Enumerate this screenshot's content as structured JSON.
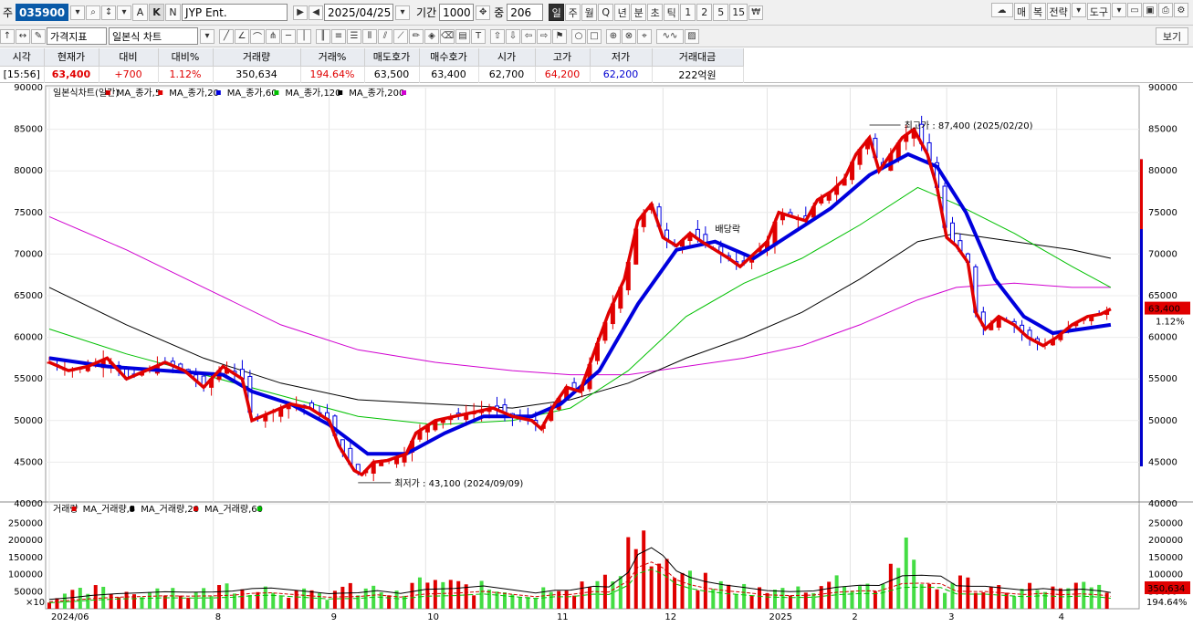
{
  "toolbar": {
    "market_label": "주",
    "stock_code": "035900",
    "letters": [
      "A",
      "K",
      "N"
    ],
    "stock_name": "JYP Ent.",
    "date": "2025/04/25",
    "period_label": "기간",
    "period_value": "1000",
    "count_label": "중",
    "count_value": "206",
    "timeframes": [
      "일",
      "주",
      "월",
      "Q",
      "년",
      "분",
      "초",
      "틱",
      "1",
      "2",
      "5",
      "15"
    ],
    "right_buttons": [
      "매",
      "복",
      "전략",
      "도구"
    ],
    "price_indicator_label": "가격지표",
    "chart_type_label": "일본식 차트",
    "view_label": "보기"
  },
  "quote": {
    "headers": [
      "시각",
      "현재가",
      "대비",
      "대비%",
      "거래량",
      "거래%",
      "매도호가",
      "매수호가",
      "시가",
      "고가",
      "저가",
      "거래대금"
    ],
    "values": [
      "[15:56]",
      "63,400",
      "+700",
      "1.12%",
      "350,634",
      "194.64%",
      "63,500",
      "63,400",
      "62,700",
      "64,200",
      "62,200",
      "222억원"
    ]
  },
  "chart_data": {
    "type": "candlestick",
    "legend_price": "일본식차트(일간) ■ MA_종가,5 ■ MA_종가,20 ■ MA_종가,60 ■ MA_종가,120 ■ MA_종가,200",
    "legend_price_items": [
      {
        "name": "일본식차트(일간)",
        "color": "#d00000"
      },
      {
        "name": "MA_종가,5",
        "color": "#e00000"
      },
      {
        "name": "MA_종가,20",
        "color": "#0000dd"
      },
      {
        "name": "MA_종가,60",
        "color": "#00c000"
      },
      {
        "name": "MA_종가,120",
        "color": "#000000"
      },
      {
        "name": "MA_종가,200",
        "color": "#d000d0"
      }
    ],
    "legend_volume_items": [
      {
        "name": "거래량",
        "color": "#e00000"
      },
      {
        "name": "MA_거래량,5",
        "color": "#000000"
      },
      {
        "name": "MA_거래량,20",
        "color": "#d00000"
      },
      {
        "name": "MA_거래량,60",
        "color": "#00c000"
      }
    ],
    "price_ylim": [
      40000,
      90000
    ],
    "price_ticks": [
      90000,
      85000,
      80000,
      75000,
      70000,
      65000,
      60000,
      55000,
      50000,
      45000,
      40000
    ],
    "volume_ylim": [
      0,
      280000
    ],
    "volume_ticks": [
      250000,
      200000,
      150000,
      100000,
      50000
    ],
    "volume_unit": "×10",
    "x_labels": [
      "2024/06",
      "8",
      "9",
      "10",
      "11",
      "12",
      "2025",
      "2",
      "3",
      "4"
    ],
    "annotations": {
      "high": "최고가 : 87,400 (2025/02/20)",
      "low": "최저가 : 43,100 (2024/09/09)",
      "dividend": "배당락"
    },
    "last_price": "63,400",
    "last_change": "1.12%",
    "last_volume": "350,634",
    "last_volume_pct": "194.64%",
    "price_path": [
      [
        0,
        57000
      ],
      [
        10,
        56000
      ],
      [
        20,
        56500
      ],
      [
        30,
        57500
      ],
      [
        40,
        55000
      ],
      [
        50,
        56000
      ],
      [
        60,
        57000
      ],
      [
        70,
        56000
      ],
      [
        80,
        54000
      ],
      [
        90,
        56500
      ],
      [
        100,
        55000
      ],
      [
        105,
        50000
      ],
      [
        115,
        51000
      ],
      [
        125,
        52000
      ],
      [
        135,
        51500
      ],
      [
        145,
        50000
      ],
      [
        150,
        47000
      ],
      [
        158,
        44000
      ],
      [
        162,
        43500
      ],
      [
        168,
        45000
      ],
      [
        175,
        45200
      ],
      [
        185,
        46000
      ],
      [
        190,
        48500
      ],
      [
        200,
        50000
      ],
      [
        210,
        50500
      ],
      [
        220,
        51000
      ],
      [
        230,
        51500
      ],
      [
        240,
        50500
      ],
      [
        250,
        50000
      ],
      [
        255,
        49000
      ],
      [
        262,
        52000
      ],
      [
        268,
        54000
      ],
      [
        275,
        53500
      ],
      [
        282,
        58000
      ],
      [
        290,
        63000
      ],
      [
        298,
        67000
      ],
      [
        305,
        74000
      ],
      [
        312,
        76000
      ],
      [
        318,
        72000
      ],
      [
        325,
        71000
      ],
      [
        332,
        72500
      ],
      [
        338,
        71500
      ],
      [
        345,
        70500
      ],
      [
        352,
        69500
      ],
      [
        358,
        68500
      ],
      [
        365,
        70000
      ],
      [
        372,
        71500
      ],
      [
        378,
        75000
      ],
      [
        385,
        74500
      ],
      [
        392,
        74000
      ],
      [
        398,
        76500
      ],
      [
        405,
        77500
      ],
      [
        412,
        79000
      ],
      [
        418,
        82000
      ],
      [
        425,
        84000
      ],
      [
        430,
        80000
      ],
      [
        436,
        82000
      ],
      [
        442,
        84000
      ],
      [
        448,
        85000
      ],
      [
        455,
        82000
      ],
      [
        460,
        78000
      ],
      [
        465,
        72000
      ],
      [
        470,
        71000
      ],
      [
        476,
        69000
      ],
      [
        480,
        63000
      ],
      [
        485,
        61000
      ],
      [
        492,
        62500
      ],
      [
        500,
        61500
      ],
      [
        507,
        60000
      ],
      [
        515,
        59000
      ],
      [
        522,
        60000
      ],
      [
        530,
        61500
      ],
      [
        538,
        62500
      ],
      [
        545,
        62800
      ],
      [
        550,
        63400
      ]
    ],
    "ma20_path": [
      [
        0,
        57500
      ],
      [
        30,
        56500
      ],
      [
        60,
        56000
      ],
      [
        90,
        55500
      ],
      [
        105,
        53500
      ],
      [
        125,
        52000
      ],
      [
        145,
        49500
      ],
      [
        165,
        46000
      ],
      [
        185,
        46000
      ],
      [
        205,
        48500
      ],
      [
        225,
        50500
      ],
      [
        250,
        50500
      ],
      [
        265,
        52000
      ],
      [
        285,
        56000
      ],
      [
        305,
        64000
      ],
      [
        325,
        70500
      ],
      [
        345,
        71500
      ],
      [
        365,
        69500
      ],
      [
        385,
        72500
      ],
      [
        405,
        75500
      ],
      [
        425,
        79500
      ],
      [
        445,
        82000
      ],
      [
        460,
        80500
      ],
      [
        475,
        75000
      ],
      [
        490,
        67000
      ],
      [
        505,
        62500
      ],
      [
        520,
        60500
      ],
      [
        535,
        61000
      ],
      [
        550,
        61500
      ]
    ],
    "ma60_path": [
      [
        0,
        61000
      ],
      [
        40,
        58000
      ],
      [
        80,
        55500
      ],
      [
        120,
        53000
      ],
      [
        160,
        50500
      ],
      [
        200,
        49500
      ],
      [
        240,
        50000
      ],
      [
        270,
        51500
      ],
      [
        300,
        56000
      ],
      [
        330,
        62500
      ],
      [
        360,
        66500
      ],
      [
        390,
        69500
      ],
      [
        420,
        73500
      ],
      [
        450,
        78000
      ],
      [
        470,
        76000
      ],
      [
        500,
        72500
      ],
      [
        530,
        68500
      ],
      [
        550,
        66000
      ]
    ],
    "ma120_path": [
      [
        0,
        66000
      ],
      [
        40,
        61500
      ],
      [
        80,
        57500
      ],
      [
        120,
        54500
      ],
      [
        160,
        52500
      ],
      [
        200,
        52000
      ],
      [
        240,
        51500
      ],
      [
        270,
        52500
      ],
      [
        300,
        54500
      ],
      [
        330,
        57500
      ],
      [
        360,
        60000
      ],
      [
        390,
        63000
      ],
      [
        420,
        67000
      ],
      [
        450,
        71500
      ],
      [
        470,
        72500
      ],
      [
        500,
        71500
      ],
      [
        530,
        70500
      ],
      [
        550,
        69500
      ]
    ],
    "ma200_path": [
      [
        0,
        74500
      ],
      [
        40,
        70500
      ],
      [
        80,
        66000
      ],
      [
        120,
        61500
      ],
      [
        160,
        58500
      ],
      [
        200,
        57000
      ],
      [
        240,
        56000
      ],
      [
        270,
        55500
      ],
      [
        300,
        55500
      ],
      [
        330,
        56500
      ],
      [
        360,
        57500
      ],
      [
        390,
        59000
      ],
      [
        420,
        61500
      ],
      [
        450,
        64500
      ],
      [
        470,
        66000
      ],
      [
        500,
        66500
      ],
      [
        530,
        66000
      ],
      [
        550,
        66000
      ]
    ],
    "volume_bars": [
      [
        0,
        32000
      ],
      [
        12,
        45000
      ],
      [
        22,
        60000
      ],
      [
        35,
        50000
      ],
      [
        48,
        55000
      ],
      [
        60,
        70000
      ],
      [
        72,
        45000
      ],
      [
        85,
        58000
      ],
      [
        95,
        80000
      ],
      [
        105,
        70000
      ],
      [
        115,
        65000
      ],
      [
        130,
        50000
      ],
      [
        145,
        40000
      ],
      [
        150,
        70000
      ],
      [
        160,
        55000
      ],
      [
        170,
        62000
      ],
      [
        182,
        40000
      ],
      [
        195,
        98000
      ],
      [
        210,
        72000
      ],
      [
        225,
        65000
      ],
      [
        240,
        58000
      ],
      [
        252,
        40000
      ],
      [
        262,
        92000
      ],
      [
        270,
        60000
      ],
      [
        282,
        80000
      ],
      [
        290,
        85000
      ],
      [
        300,
        210000
      ],
      [
        305,
        265000
      ],
      [
        312,
        155000
      ],
      [
        318,
        130000
      ],
      [
        325,
        105000
      ],
      [
        332,
        90000
      ],
      [
        340,
        85000
      ],
      [
        350,
        70000
      ],
      [
        360,
        65000
      ],
      [
        372,
        52000
      ],
      [
        384,
        60000
      ],
      [
        396,
        72000
      ],
      [
        408,
        90000
      ],
      [
        420,
        80000
      ],
      [
        430,
        70000
      ],
      [
        442,
        190000
      ],
      [
        452,
        85000
      ],
      [
        462,
        62000
      ],
      [
        470,
        90000
      ],
      [
        478,
        80000
      ],
      [
        485,
        62000
      ],
      [
        495,
        70000
      ],
      [
        505,
        60000
      ],
      [
        515,
        78000
      ],
      [
        525,
        52000
      ],
      [
        535,
        72000
      ],
      [
        545,
        60000
      ],
      [
        550,
        35000
      ]
    ]
  }
}
